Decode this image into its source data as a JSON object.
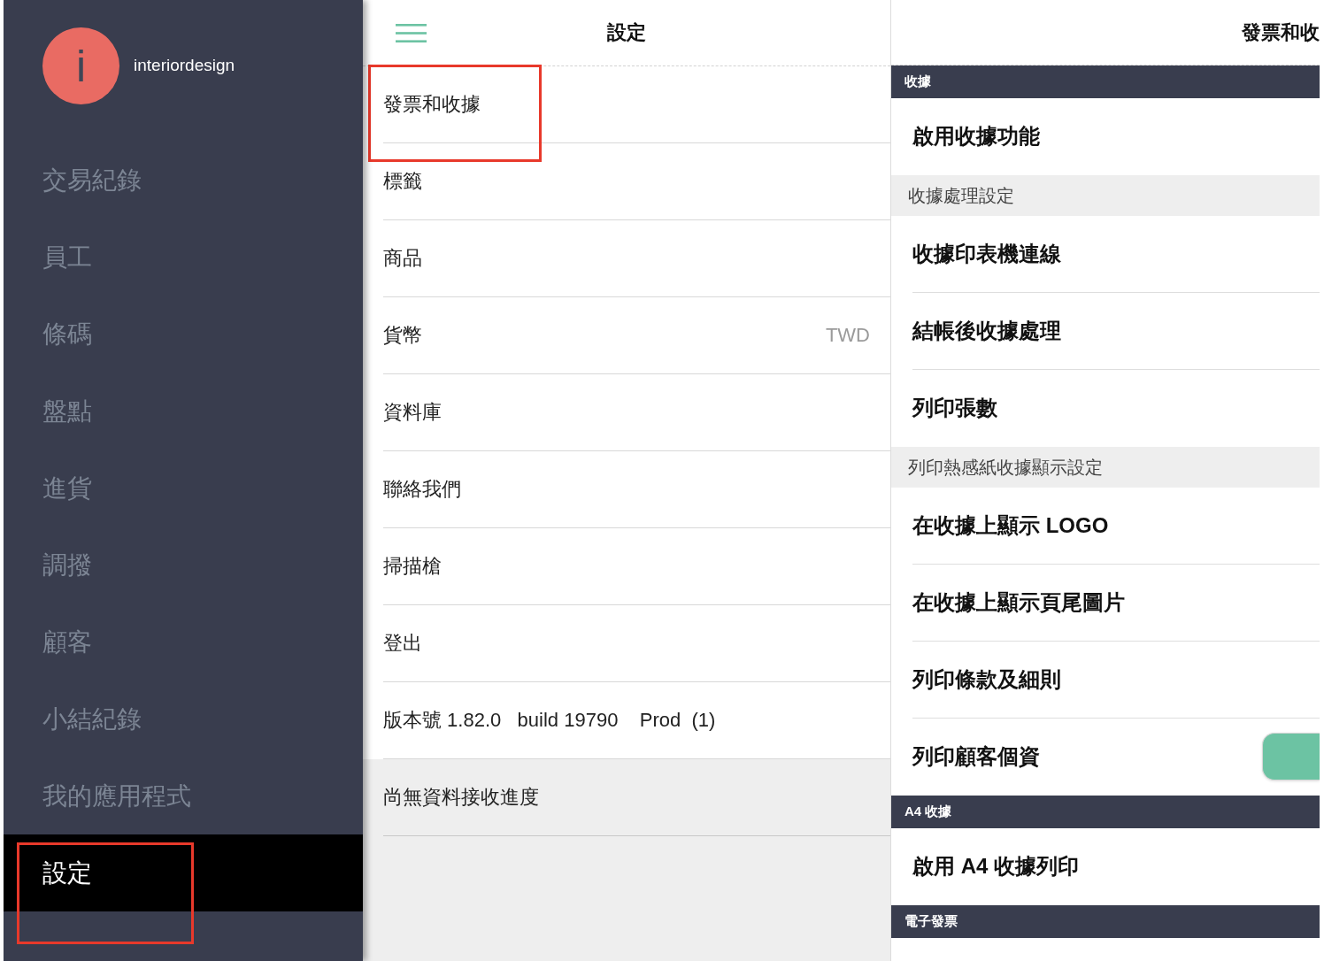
{
  "sidebar": {
    "account": {
      "avatar_letter": "i",
      "name": "interiordesign"
    },
    "items": [
      {
        "label": "交易紀錄",
        "selected": false,
        "annotated": false
      },
      {
        "label": "員工",
        "selected": false,
        "annotated": false
      },
      {
        "label": "條碼",
        "selected": false,
        "annotated": false
      },
      {
        "label": "盤點",
        "selected": false,
        "annotated": false
      },
      {
        "label": "進貨",
        "selected": false,
        "annotated": false
      },
      {
        "label": "調撥",
        "selected": false,
        "annotated": false
      },
      {
        "label": "顧客",
        "selected": false,
        "annotated": false
      },
      {
        "label": "小結紀錄",
        "selected": false,
        "annotated": false
      },
      {
        "label": "我的應用程式",
        "selected": false,
        "annotated": false
      },
      {
        "label": "設定",
        "selected": true,
        "annotated": true
      }
    ]
  },
  "settings_panel": {
    "title": "設定",
    "items": [
      {
        "label": "發票和收據",
        "annotated": true
      },
      {
        "label": "標籤",
        "annotated": false
      },
      {
        "label": "商品",
        "annotated": false
      },
      {
        "label": "貨幣",
        "value": "TWD",
        "annotated": false
      },
      {
        "label": "資料庫",
        "annotated": false
      },
      {
        "label": "聯絡我們",
        "annotated": false
      },
      {
        "label": "掃描槍",
        "annotated": false
      },
      {
        "label": "登出",
        "annotated": false
      },
      {
        "label": "版本號 1.82.0   build 19790    Prod  (1)",
        "annotated": false
      }
    ],
    "sync_status": "尚無資料接收進度"
  },
  "detail_panel": {
    "title": "發票和收",
    "sections": [
      {
        "kind": "section",
        "label": "收據"
      },
      {
        "kind": "option",
        "label": "啟用收據功能"
      },
      {
        "kind": "group",
        "label": "收據處理設定"
      },
      {
        "kind": "option",
        "label": "收據印表機連線"
      },
      {
        "kind": "option",
        "label": "結帳後收據處理"
      },
      {
        "kind": "option",
        "label": "列印張數"
      },
      {
        "kind": "group",
        "label": "列印熱感紙收據顯示設定"
      },
      {
        "kind": "option",
        "label": "在收據上顯示 LOGO"
      },
      {
        "kind": "option",
        "label": "在收據上顯示頁尾圖片"
      },
      {
        "kind": "option",
        "label": "列印條款及細則"
      },
      {
        "kind": "switch",
        "label": "列印顧客個資",
        "on": true
      },
      {
        "kind": "section",
        "label": "A4 收據"
      },
      {
        "kind": "option",
        "label": "啟用 A4 收據列印"
      },
      {
        "kind": "section",
        "label": "電子發票"
      }
    ]
  }
}
